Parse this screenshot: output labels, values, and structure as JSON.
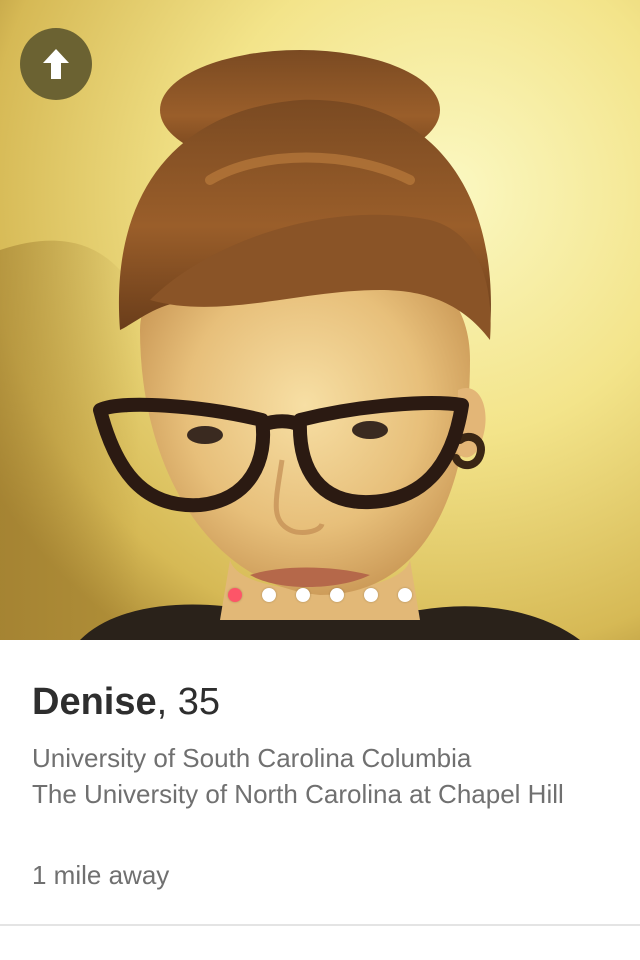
{
  "profile": {
    "name": "Denise",
    "separator": ",",
    "age": "35",
    "schools": [
      "University of South Carolina Columbia",
      "The University of North Carolina at Chapel Hill"
    ],
    "distance": "1 mile away"
  },
  "photo": {
    "dot_count": 6,
    "active_index": 0
  },
  "icons": {
    "collapse": "arrow-up-icon"
  },
  "colors": {
    "active_dot": "#fd5568",
    "inactive_dot": "#ffffff",
    "collapse_button": "#6b6232",
    "name_text": "#2e2e2e",
    "secondary_text": "#707070"
  }
}
